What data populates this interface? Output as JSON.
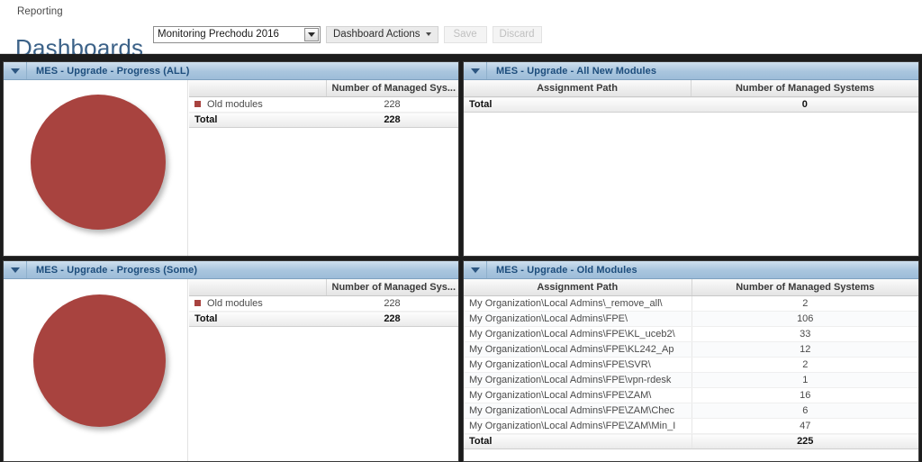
{
  "header": {
    "breadcrumb": "Reporting",
    "title": "Dashboards",
    "dashboard_select": {
      "value": "Monitoring Prechodu 2016",
      "icon": "chevron-down-icon"
    },
    "actions_button": {
      "label": "Dashboard Actions",
      "icon": "chevron-down-icon"
    },
    "save_button": {
      "label": "Save",
      "enabled": false
    },
    "discard_button": {
      "label": "Discard",
      "enabled": false
    }
  },
  "colors": {
    "pie_red": "#a8433f",
    "panel_header_blue": "#a9c5de",
    "title_blue": "#3c6288"
  },
  "panels": {
    "top_left": {
      "title": "MES - Upgrade - Progress (ALL)",
      "toggle_icon": "triangle-down-icon",
      "columns": [
        "",
        "Number of Managed Sys..."
      ],
      "rows": [
        {
          "label": "Old modules",
          "value": "228",
          "swatch": "#a8433f"
        }
      ],
      "total": {
        "label": "Total",
        "value": "228"
      }
    },
    "top_right": {
      "title": "MES - Upgrade - All New Modules",
      "toggle_icon": "triangle-down-icon",
      "columns": [
        "Assignment Path",
        "Number of Managed Systems"
      ],
      "rows": [],
      "total": {
        "label": "Total",
        "value": "0"
      }
    },
    "bottom_left": {
      "title": "MES - Upgrade - Progress (Some)",
      "toggle_icon": "triangle-down-icon",
      "columns": [
        "",
        "Number of Managed Sys..."
      ],
      "rows": [
        {
          "label": "Old modules",
          "value": "228",
          "swatch": "#a8433f"
        }
      ],
      "total": {
        "label": "Total",
        "value": "228"
      }
    },
    "bottom_right": {
      "title": "MES - Upgrade - Old Modules",
      "toggle_icon": "triangle-down-icon",
      "columns": [
        "Assignment Path",
        "Number of Managed Systems"
      ],
      "rows": [
        {
          "path": "My Organization\\Local Admins\\_remove_all\\",
          "value": "2"
        },
        {
          "path": "My Organization\\Local Admins\\FPE\\",
          "value": "106"
        },
        {
          "path": "My Organization\\Local Admins\\FPE\\KL_uceb2\\",
          "value": "33"
        },
        {
          "path": "My Organization\\Local Admins\\FPE\\KL242_Ap",
          "value": "12"
        },
        {
          "path": "My Organization\\Local Admins\\FPE\\SVR\\",
          "value": "2"
        },
        {
          "path": "My Organization\\Local Admins\\FPE\\vpn-rdesk",
          "value": "1"
        },
        {
          "path": "My Organization\\Local Admins\\FPE\\ZAM\\",
          "value": "16"
        },
        {
          "path": "My Organization\\Local Admins\\FPE\\ZAM\\Chec",
          "value": "6"
        },
        {
          "path": "My Organization\\Local Admins\\FPE\\ZAM\\Min_I",
          "value": "47"
        }
      ],
      "total": {
        "label": "Total",
        "value": "225"
      }
    }
  },
  "chart_data": [
    {
      "type": "pie",
      "title": "MES - Upgrade - Progress (ALL)",
      "labels": [
        "Old modules"
      ],
      "values": [
        228
      ],
      "colors": [
        "#a8433f"
      ],
      "total": 228,
      "legend_position": "right"
    },
    {
      "type": "pie",
      "title": "MES - Upgrade - Progress (Some)",
      "labels": [
        "Old modules"
      ],
      "values": [
        228
      ],
      "colors": [
        "#a8433f"
      ],
      "total": 228,
      "legend_position": "right"
    }
  ]
}
